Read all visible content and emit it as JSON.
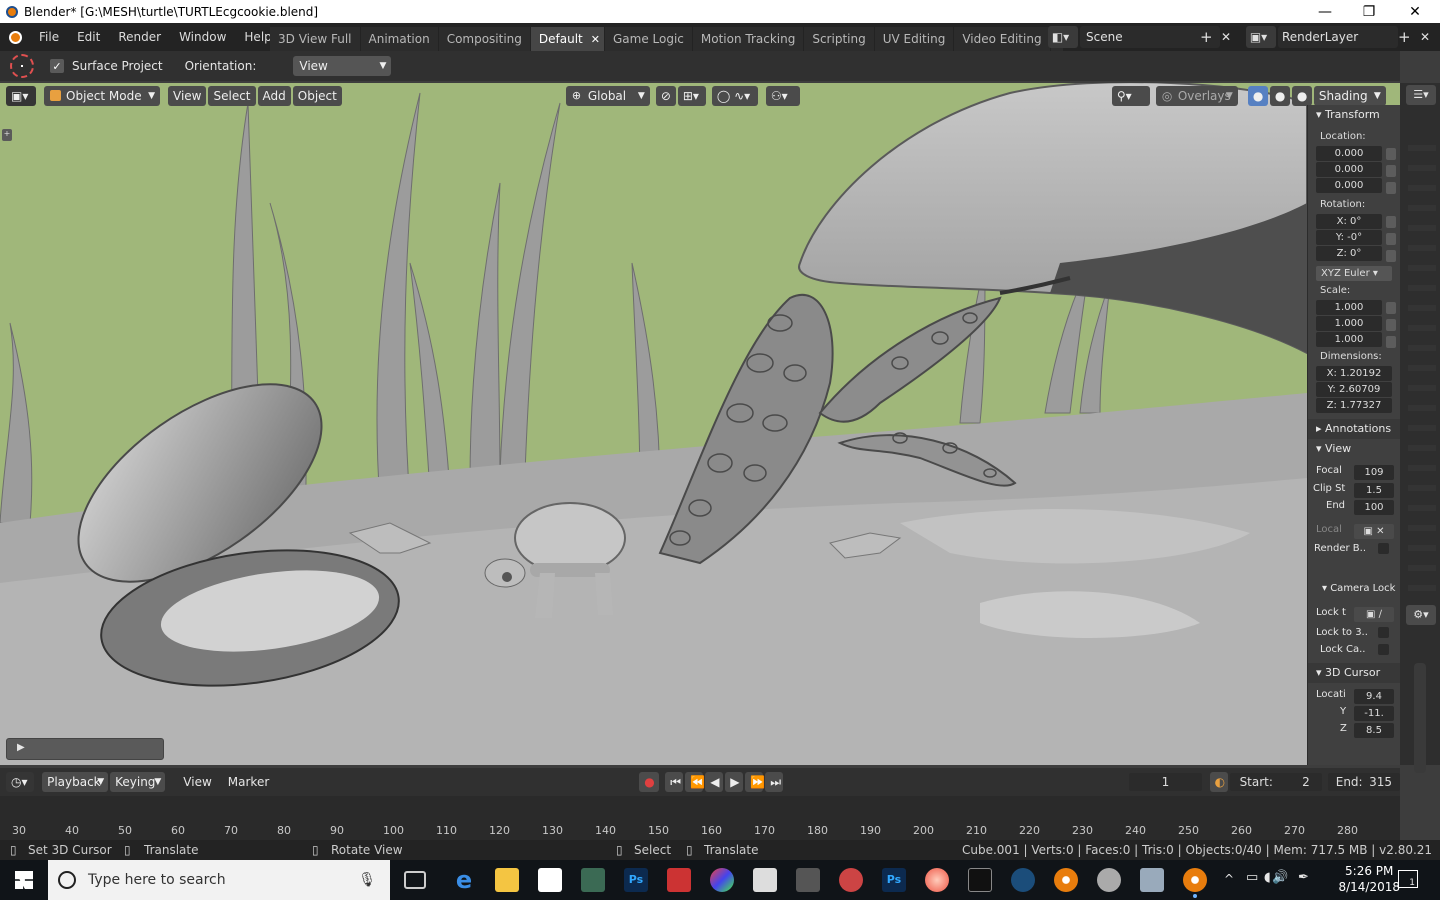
{
  "window": {
    "title": "Blender* [G:\\MESH\\turtle\\TURTLEcgcookie.blend]",
    "minimize": "—",
    "maximize": "❐",
    "close": "✕"
  },
  "menu": [
    "File",
    "Edit",
    "Render",
    "Window",
    "Help"
  ],
  "workspaces": [
    {
      "label": "3D View Full"
    },
    {
      "label": "Animation"
    },
    {
      "label": "Compositing"
    },
    {
      "label": "Default",
      "active": true
    },
    {
      "label": "Game Logic"
    },
    {
      "label": "Motion Tracking"
    },
    {
      "label": "Scripting"
    },
    {
      "label": "UV Editing"
    },
    {
      "label": "Video Editing"
    }
  ],
  "scene": {
    "name": "Scene",
    "render_layer": "RenderLayer"
  },
  "tool_options": {
    "surface_project_label": "Surface Project",
    "surface_project_checked": true,
    "orientation_label": "Orientation:",
    "orientation_value": "View"
  },
  "viewport_header": {
    "mode": "Object Mode",
    "menus": [
      "View",
      "Select",
      "Add",
      "Object"
    ],
    "transform_orientation": "Global",
    "overlays": "Overlays",
    "shading": "Shading"
  },
  "n_panel": {
    "transform": {
      "header": "Transform",
      "location_label": "Location:",
      "location": [
        "0.000",
        "0.000",
        "0.000"
      ],
      "rotation_label": "Rotation:",
      "rotation": [
        "X:  0°",
        "Y:  -0°",
        "Z:  0°"
      ],
      "rotation_mode": "XYZ Euler",
      "scale_label": "Scale:",
      "scale": [
        "1.000",
        "1.000",
        "1.000"
      ],
      "dimensions_label": "Dimensions:",
      "dimensions": [
        "X: 1.20192",
        "Y: 2.60709",
        "Z: 1.77327"
      ]
    },
    "annotations": "Annotations",
    "view": {
      "header": "View",
      "focal_label": "Focal",
      "focal": "109",
      "clip_start_label": "Clip St",
      "clip_start": "1.5",
      "clip_end_label": "End",
      "clip_end": "100",
      "local_label": "Local",
      "render_border_label": "Render B.."
    },
    "camera_lock": {
      "header": "Camera Lock",
      "lock_label": "Lock t",
      "lock_to_3d_label": "Lock to 3..",
      "lock_camera_label": "Lock Ca.."
    },
    "cursor": {
      "header": "3D Cursor",
      "location_label": "Locati",
      "x": "9.4",
      "y_label": "Y",
      "y": "-11.",
      "z_label": "Z",
      "z": "8.5"
    }
  },
  "timeline": {
    "playback": "Playback",
    "keying": "Keying",
    "view": "View",
    "marker": "Marker",
    "current_frame": "1",
    "start_label": "Start:",
    "start": "2",
    "end_label": "End:",
    "end": "315",
    "ruler": [
      "30",
      "40",
      "50",
      "60",
      "70",
      "80",
      "90",
      "100",
      "110",
      "120",
      "130",
      "140",
      "150",
      "160",
      "170",
      "180",
      "190",
      "200",
      "210",
      "220",
      "230",
      "240",
      "250",
      "260",
      "270",
      "280"
    ]
  },
  "statusbar": {
    "left": [
      "Set 3D Cursor",
      "Translate",
      "Rotate View"
    ],
    "middle": [
      "Select",
      "Translate"
    ],
    "info": "Cube.001 | Verts:0 | Faces:0 | Tris:0 | Objects:0/40 | Mem: 717.5 MB | v2.80.21"
  },
  "taskbar": {
    "search_placeholder": "Type here to search",
    "time": "5:26 PM",
    "date": "8/14/2018",
    "notification_count": "1"
  },
  "colors": {
    "sky": "#a0b77a",
    "blender_orange": "#e87d0d",
    "ui_dark": "#232323",
    "panel": "#404040"
  }
}
